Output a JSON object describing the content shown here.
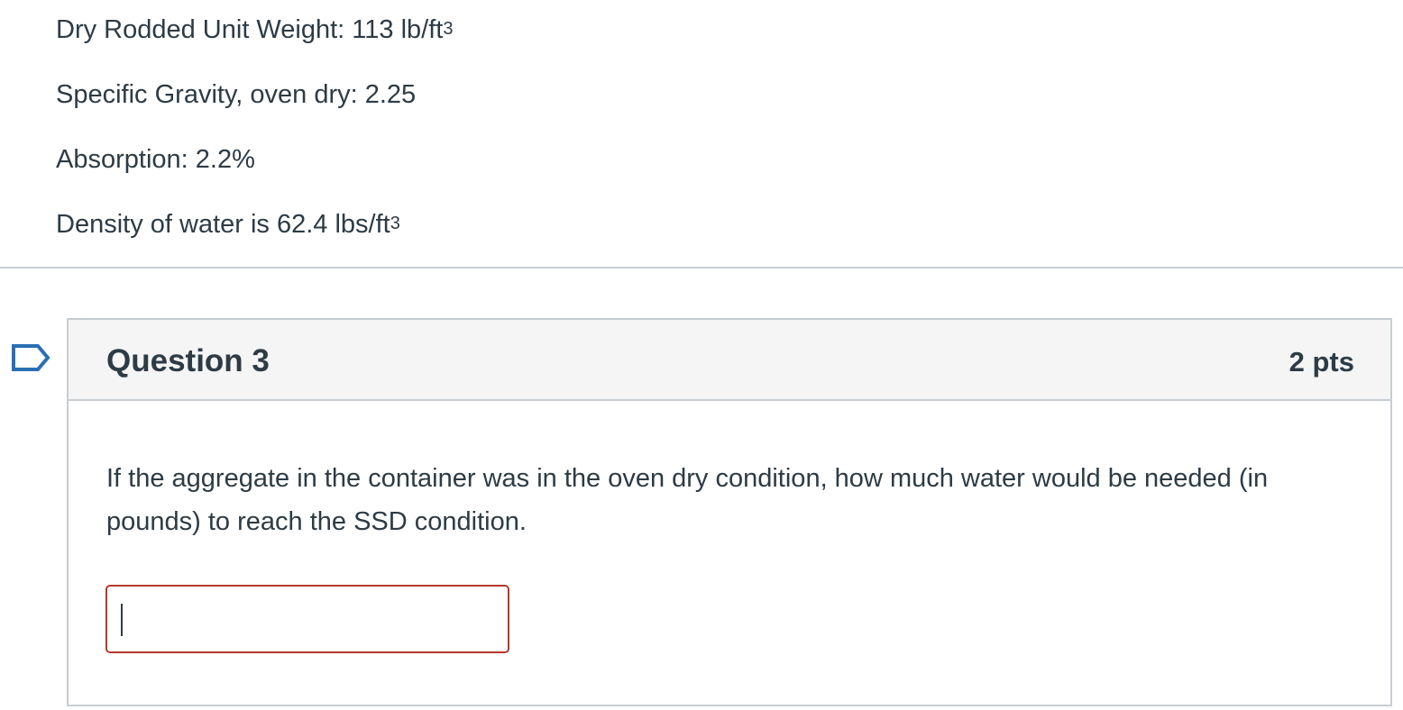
{
  "previous_question": {
    "lines": [
      {
        "label": "Dry Rodded Unit Weight: 113 lb/ft",
        "superscript": "3"
      },
      {
        "label": "Specific Gravity, oven dry: 2.25",
        "superscript": ""
      },
      {
        "label": "Absorption: 2.2%",
        "superscript": ""
      },
      {
        "label": "Density of water is 62.4 lbs/ft",
        "superscript": "3"
      }
    ]
  },
  "question": {
    "title": "Question 3",
    "points": "2 pts",
    "text": "If the aggregate in the container was in the oven dry condition, how much water would be needed (in pounds) to reach the SSD condition.",
    "answer_value": "",
    "answer_placeholder": ""
  },
  "icons": {
    "flag": "flag-question-icon"
  },
  "colors": {
    "text": "#2d3b45",
    "header_background": "#f5f5f5",
    "border": "#c7cdd1",
    "input_error_border": "#b33a2b"
  }
}
